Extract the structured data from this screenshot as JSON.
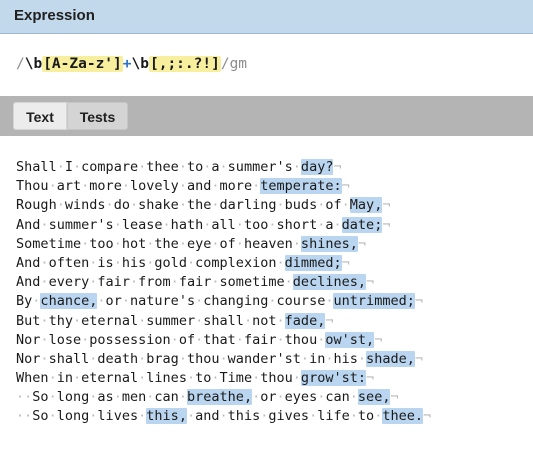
{
  "panel": {
    "title": "Expression"
  },
  "expression": {
    "open_delim": "/",
    "parts": [
      {
        "text": "\\b",
        "kind": "esc"
      },
      {
        "text": "[A-Za-z']",
        "kind": "set"
      },
      {
        "text": "+",
        "kind": "quant"
      },
      {
        "text": "\\b",
        "kind": "esc"
      },
      {
        "text": "[,;:.?!]",
        "kind": "set"
      }
    ],
    "close_delim": "/",
    "flags": "gm"
  },
  "tabs": [
    {
      "label": "Text",
      "active": true
    },
    {
      "label": "Tests",
      "active": false
    }
  ],
  "text_lines": [
    [
      {
        "t": "Shall I compare thee to a summer's "
      },
      {
        "t": "day?",
        "m": true
      }
    ],
    [
      {
        "t": "Thou art more lovely and more "
      },
      {
        "t": "temperate:",
        "m": true
      }
    ],
    [
      {
        "t": "Rough winds do shake the darling buds of "
      },
      {
        "t": "May,",
        "m": true
      }
    ],
    [
      {
        "t": "And summer's lease hath all too short a "
      },
      {
        "t": "date;",
        "m": true
      }
    ],
    [
      {
        "t": "Sometime too hot the eye of heaven "
      },
      {
        "t": "shines,",
        "m": true
      }
    ],
    [
      {
        "t": "And often is his gold complexion "
      },
      {
        "t": "dimmed;",
        "m": true
      }
    ],
    [
      {
        "t": "And every fair from fair sometime "
      },
      {
        "t": "declines,",
        "m": true
      }
    ],
    [
      {
        "t": "By "
      },
      {
        "t": "chance,",
        "m": true
      },
      {
        "t": " or nature's changing course "
      },
      {
        "t": "untrimmed;",
        "m": true
      }
    ],
    [
      {
        "t": "But thy eternal summer shall not "
      },
      {
        "t": "fade,",
        "m": true
      }
    ],
    [
      {
        "t": "Nor lose possession of that fair thou "
      },
      {
        "t": "ow'st,",
        "m": true
      }
    ],
    [
      {
        "t": "Nor shall death brag thou wander'st in his "
      },
      {
        "t": "shade,",
        "m": true
      }
    ],
    [
      {
        "t": "When in eternal lines to Time thou "
      },
      {
        "t": "grow'st:",
        "m": true
      }
    ],
    [
      {
        "t": "  So long as men can "
      },
      {
        "t": "breathe,",
        "m": true
      },
      {
        "t": " or eyes can "
      },
      {
        "t": "see,",
        "m": true
      }
    ],
    [
      {
        "t": "  So long lives "
      },
      {
        "t": "this,",
        "m": true
      },
      {
        "t": " and this gives life to "
      },
      {
        "t": "thee.",
        "m": true
      }
    ]
  ],
  "colors": {
    "header_bg": "#c2d9ec",
    "match_highlight": "#b9d5ef",
    "char_set_highlight": "#f7ee9e",
    "quantifier": "#2f71c8",
    "tabs_bar": "#b4b4b4"
  }
}
